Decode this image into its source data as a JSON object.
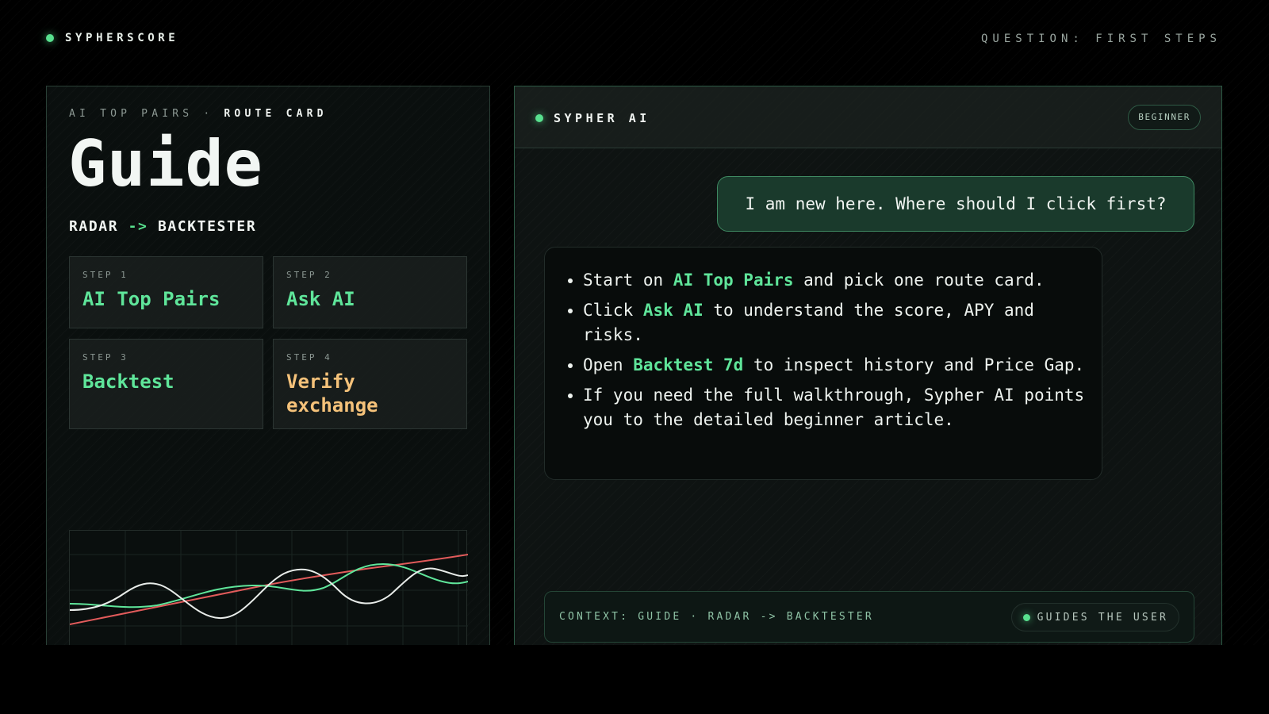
{
  "header": {
    "brand": "SYPHERSCORE",
    "question": "QUESTION: FIRST STEPS"
  },
  "left_panel": {
    "kicker_prefix": "AI TOP PAIRS · ",
    "kicker_strong": "ROUTE CARD",
    "title": "Guide",
    "route_from": "RADAR",
    "route_arrow": "->",
    "route_to": "BACKTESTER",
    "steps": [
      {
        "label": "STEP 1",
        "name": "AI Top Pairs"
      },
      {
        "label": "STEP 2",
        "name": "Ask AI"
      },
      {
        "label": "STEP 3",
        "name": "Backtest"
      },
      {
        "label": "STEP 4",
        "name": "Verify exchange"
      }
    ]
  },
  "chat": {
    "assistant_name": "SYPHER AI",
    "level_badge": "BEGINNER",
    "user_message": "I am new here. Where should I click first?",
    "answer": [
      {
        "pre": "Start on ",
        "hl": "AI Top Pairs",
        "post": " and pick one route card."
      },
      {
        "pre": "Click ",
        "hl": "Ask AI",
        "post": " to understand the score, APY and risks."
      },
      {
        "pre": "Open ",
        "hl": "Backtest 7d",
        "post": " to inspect history and Price Gap."
      },
      {
        "pre": "If you need the full walkthrough, Sypher AI points you to the detailed beginner article.",
        "hl": "",
        "post": ""
      }
    ],
    "context": "CONTEXT: GUIDE · RADAR -> BACKTESTER",
    "status": "GUIDES THE USER"
  },
  "colors": {
    "accent": "#58e08e",
    "warning": "#f5c27a",
    "line_white": "#e8ece9",
    "line_green": "#5fe59a",
    "line_red": "#e25b5b"
  },
  "icons": {
    "brand_dot": "status-dot-icon",
    "assistant_dot": "status-dot-icon",
    "status_dot": "status-dot-icon"
  }
}
